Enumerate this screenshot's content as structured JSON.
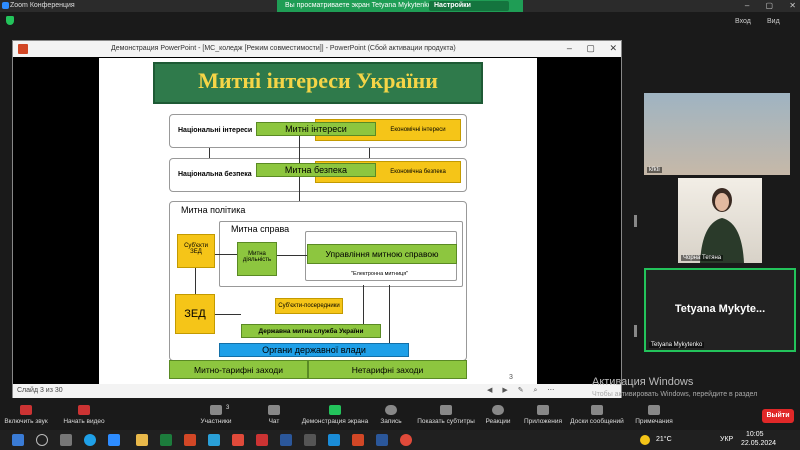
{
  "zoom": {
    "window_title": "Zoom Конференция",
    "share_banner": "Вы просматриваете экран Tetyana Mykytenko",
    "view_options": "Настройки просмотра",
    "enter_label": "Вход",
    "view_label": "Вид"
  },
  "ppt": {
    "window_title": "Демонстрация PowerPoint - [МС_коледж [Режим совместимости]] - PowerPoint (Сбой активации продукта)",
    "slide_counter": "Слайд 3 из 30",
    "page_number": "3"
  },
  "slide": {
    "title": "Митні інтереси України",
    "national_interests": "Національні інтереси",
    "customs_interests": "Митні інтереси",
    "economic_interests": "Економічні інтереси",
    "national_security": "Національна безпека",
    "customs_security": "Митна безпека",
    "economic_security": "Економічна безпека",
    "customs_policy": "Митна політика",
    "customs_affairs": "Митна справа",
    "zed_subjects": "Суб'єкти ЗЕД",
    "customs_activity": "Митна діяльність",
    "customs_management": "Управління митною справою",
    "electronic_customs": "\"Електронна митниця\"",
    "zed": "ЗЕД",
    "intermediaries": "Суб'єкти-посередники",
    "state_customs_service": "Державна митна служба України",
    "state_authorities": "Органи державної влади",
    "tariff_measures": "Митно-тарифні заходи",
    "nontariff_measures": "Нетарифні заходи"
  },
  "participants": {
    "classroom_name": "kfkti",
    "teacher_name": "Чорна Тетяна",
    "self_name_big": "Tetyana Mykyte...",
    "self_name": "Tetyana Mykytenko"
  },
  "watermark": {
    "title": "Активация Windows",
    "subtitle": "Чтобы активировать Windows, перейдите в раздел \"Параметры\"."
  },
  "toolbar": {
    "mute": "Включить звук",
    "video": "Начать видео",
    "participants": "Участники",
    "participants_count": "3",
    "chat": "Чат",
    "share": "Демонстрация экрана",
    "record": "Запись",
    "captions": "Показать субтитры",
    "reactions": "Реакции",
    "apps": "Приложения",
    "whiteboard": "Доски сообщений",
    "notes": "Примечания",
    "leave": "Выйти"
  },
  "taskbar": {
    "temperature": "21°C",
    "language": "УКР",
    "time": "10:05",
    "date": "22.05.2024"
  }
}
